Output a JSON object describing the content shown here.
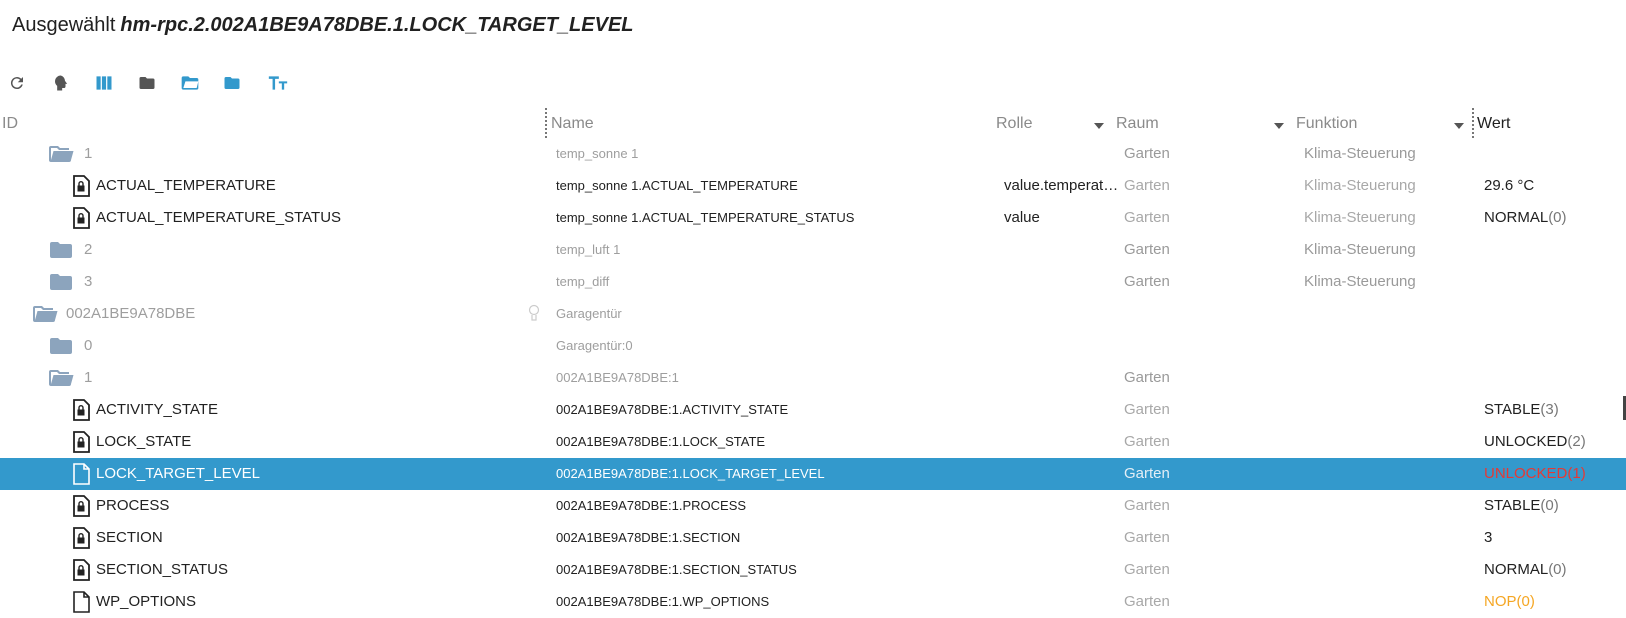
{
  "header": {
    "prefix": "Ausgewählt",
    "selected": "hm-rpc.2.002A1BE9A78DBE.1.LOCK_TARGET_LEVEL"
  },
  "toolbar": [
    {
      "name": "refresh-icon",
      "color": "#555555"
    },
    {
      "name": "expert-mode-icon",
      "color": "#555555"
    },
    {
      "name": "columns-icon",
      "color": "#3399cc"
    },
    {
      "name": "collapse-folders-icon",
      "color": "#555555"
    },
    {
      "name": "expand-folders-icon",
      "color": "#3399cc"
    },
    {
      "name": "folder-icon",
      "color": "#3399cc"
    },
    {
      "name": "text-size-icon",
      "color": "#3399cc"
    }
  ],
  "columns": {
    "id": "ID",
    "name": "Name",
    "role": "Rolle",
    "room": "Raum",
    "func": "Funktion",
    "value": "Wert"
  },
  "colors": {
    "accent": "#3399cc",
    "folder": "#8ca4bd",
    "unlocked": "#e53935",
    "nop": "#f5a623"
  },
  "rows": [
    {
      "type": "folder-open",
      "id": "1",
      "name": "temp_sonne 1",
      "role": "",
      "room": "Garten",
      "func": "Klima-Steuerung",
      "value": "",
      "unit": ""
    },
    {
      "type": "state-locked",
      "id": "ACTUAL_TEMPERATURE",
      "name": "temp_sonne 1.ACTUAL_TEMPERATURE",
      "role": "value.temperature",
      "room": "Garten",
      "func": "Klima-Steuerung",
      "value": "29.6 °C",
      "unit": ""
    },
    {
      "type": "state-locked",
      "id": "ACTUAL_TEMPERATURE_STATUS",
      "name": "temp_sonne 1.ACTUAL_TEMPERATURE_STATUS",
      "role": "value",
      "room": "Garten",
      "func": "Klima-Steuerung",
      "value": "NORMAL",
      "unit": "(0)"
    },
    {
      "type": "folder",
      "id": "2",
      "name": "temp_luft 1",
      "role": "",
      "room": "Garten",
      "func": "Klima-Steuerung",
      "value": "",
      "unit": ""
    },
    {
      "type": "folder",
      "id": "3",
      "name": "temp_diff",
      "role": "",
      "room": "Garten",
      "func": "Klima-Steuerung",
      "value": "",
      "unit": ""
    },
    {
      "type": "device-open",
      "id": "002A1BE9A78DBE",
      "name": "Garagentür",
      "role": "",
      "room": "",
      "func": "",
      "value": "",
      "unit": ""
    },
    {
      "type": "folder",
      "id": "0",
      "name": "Garagentür:0",
      "role": "",
      "room": "",
      "func": "",
      "value": "",
      "unit": ""
    },
    {
      "type": "folder-open",
      "id": "1",
      "name": "002A1BE9A78DBE:1",
      "role": "",
      "room": "Garten",
      "func": "",
      "value": "",
      "unit": ""
    },
    {
      "type": "state-locked",
      "id": "ACTIVITY_STATE",
      "name": "002A1BE9A78DBE:1.ACTIVITY_STATE",
      "role": "",
      "room": "Garten",
      "func": "",
      "value": "STABLE",
      "unit": "(3)"
    },
    {
      "type": "state-locked",
      "id": "LOCK_STATE",
      "name": "002A1BE9A78DBE:1.LOCK_STATE",
      "role": "",
      "room": "Garten",
      "func": "",
      "value": "UNLOCKED",
      "unit": "(2)"
    },
    {
      "type": "state-file",
      "id": "LOCK_TARGET_LEVEL",
      "name": "002A1BE9A78DBE:1.LOCK_TARGET_LEVEL",
      "role": "",
      "room": "Garten",
      "func": "",
      "value": "UNLOCKED",
      "unit": "(1)",
      "selected": true,
      "valueColor": "red"
    },
    {
      "type": "state-locked",
      "id": "PROCESS",
      "name": "002A1BE9A78DBE:1.PROCESS",
      "role": "",
      "room": "Garten",
      "func": "",
      "value": "STABLE",
      "unit": "(0)"
    },
    {
      "type": "state-locked",
      "id": "SECTION",
      "name": "002A1BE9A78DBE:1.SECTION",
      "role": "",
      "room": "Garten",
      "func": "",
      "value": "3",
      "unit": ""
    },
    {
      "type": "state-locked",
      "id": "SECTION_STATUS",
      "name": "002A1BE9A78DBE:1.SECTION_STATUS",
      "role": "",
      "room": "Garten",
      "func": "",
      "value": "NORMAL",
      "unit": "(0)"
    },
    {
      "type": "state-file",
      "id": "WP_OPTIONS",
      "name": "002A1BE9A78DBE:1.WP_OPTIONS",
      "role": "",
      "room": "Garten",
      "func": "",
      "value": "NOP",
      "unit": "(0)",
      "valueColor": "orange"
    }
  ]
}
